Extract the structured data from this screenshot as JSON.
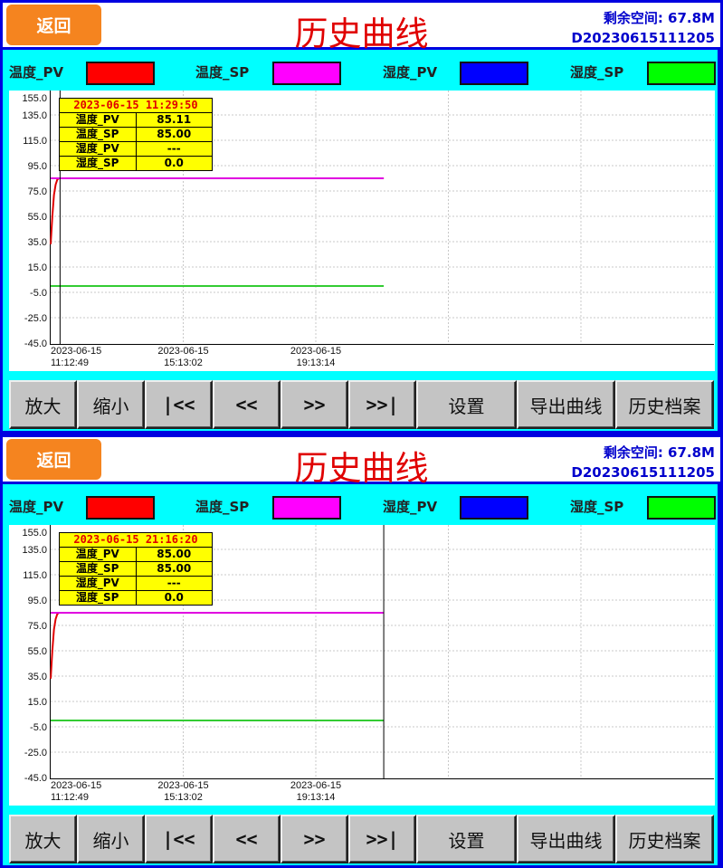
{
  "header": {
    "back_label": "返回",
    "title": "历史曲线",
    "free_space": "剩余空间: 67.8M",
    "file_id": "D20230615111205"
  },
  "legend": [
    {
      "label": "温度_PV",
      "color": "#ff0000"
    },
    {
      "label": "温度_SP",
      "color": "#ff00ff"
    },
    {
      "label": "湿度_PV",
      "color": "#0000ff"
    },
    {
      "label": "湿度_SP",
      "color": "#00ff00"
    }
  ],
  "buttons": [
    "放大",
    "缩小",
    "|<<",
    "<<",
    ">>",
    ">>|",
    "设置",
    "导出曲线",
    "历史档案"
  ],
  "panels": [
    {
      "cursor_time": "2023-06-15 11:29:50",
      "cursor_min": 17,
      "rows": [
        {
          "name": "温度_PV",
          "value": "85.11"
        },
        {
          "name": "温度_SP",
          "value": "85.00"
        },
        {
          "name": "湿度_PV",
          "value": "---"
        },
        {
          "name": "湿度_SP",
          "value": "0.0"
        }
      ]
    },
    {
      "cursor_time": "2023-06-15 21:16:20",
      "cursor_min": 603.5,
      "rows": [
        {
          "name": "温度_PV",
          "value": "85.00"
        },
        {
          "name": "温度_SP",
          "value": "85.00"
        },
        {
          "name": "湿度_PV",
          "value": "---"
        },
        {
          "name": "湿度_SP",
          "value": "0.0"
        }
      ]
    }
  ],
  "chart_data": {
    "type": "line",
    "x_unit": "minutes since 2023-06-15 11:12:49",
    "x_ticks": [
      {
        "min": 0,
        "date": "2023-06-15",
        "time": "11:12:49"
      },
      {
        "min": 240.2,
        "date": "2023-06-15",
        "time": "15:13:02"
      },
      {
        "min": 480.4,
        "date": "2023-06-15",
        "time": "19:13:14"
      }
    ],
    "xlim": [
      0,
      960.8
    ],
    "ylim": [
      -45,
      155
    ],
    "y_ticks": [
      "155.0",
      "135.0",
      "115.0",
      "95.0",
      "75.0",
      "55.0",
      "35.0",
      "15.0",
      "-5.0",
      "-25.0",
      "-45.0"
    ],
    "grid": true,
    "series": [
      {
        "name": "温度_PV",
        "color": "#e00000",
        "points": [
          [
            0,
            33
          ],
          [
            3,
            55
          ],
          [
            6,
            72
          ],
          [
            9,
            80
          ],
          [
            12,
            84
          ],
          [
            15,
            85
          ],
          [
            603.5,
            85
          ]
        ]
      },
      {
        "name": "温度_SP",
        "color": "#e000e0",
        "points": [
          [
            0,
            85
          ],
          [
            603.5,
            85
          ]
        ]
      },
      {
        "name": "湿度_PV",
        "color": "#0000ff",
        "points": []
      },
      {
        "name": "湿度_SP",
        "color": "#33cc33",
        "points": [
          [
            0,
            0
          ],
          [
            603.5,
            0
          ]
        ]
      }
    ]
  }
}
